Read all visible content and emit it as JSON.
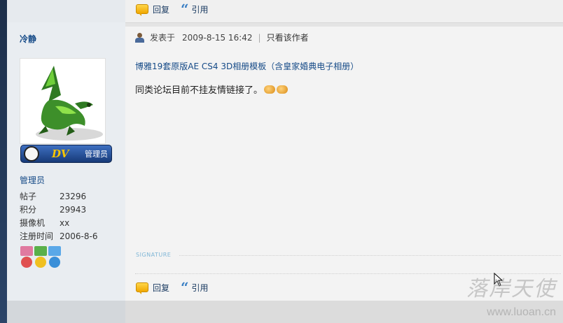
{
  "top_actions": {
    "reply": "回复",
    "quote": "引用"
  },
  "user": {
    "name": "冷静",
    "badge_text": "管理员",
    "badge_logo": "DV",
    "rank": "管理员",
    "stats": [
      {
        "label": "帖子",
        "value": "23296"
      },
      {
        "label": "积分",
        "value": "29943"
      },
      {
        "label": "摄像机",
        "value": "xx"
      },
      {
        "label": "注册时间",
        "value": "2006-8-6"
      }
    ],
    "medal_colors": [
      "#e05050",
      "#4aa84a",
      "#3a8fd8"
    ]
  },
  "post": {
    "posted_prefix": "发表于",
    "posted_time": "2009-8-15 16:42",
    "separator": "|",
    "only_author": "只看该作者",
    "thread_title": "博雅19套原版AE CS4 3D相册模板（含皇家婚典电子相册）",
    "body": "同类论坛目前不挂友情链接了。"
  },
  "signature_label": "SIGNATURE",
  "bottom_actions": {
    "reply": "回复",
    "quote": "引用"
  },
  "watermark": {
    "text": "落岸天使",
    "url": "www.luoan.cn"
  }
}
